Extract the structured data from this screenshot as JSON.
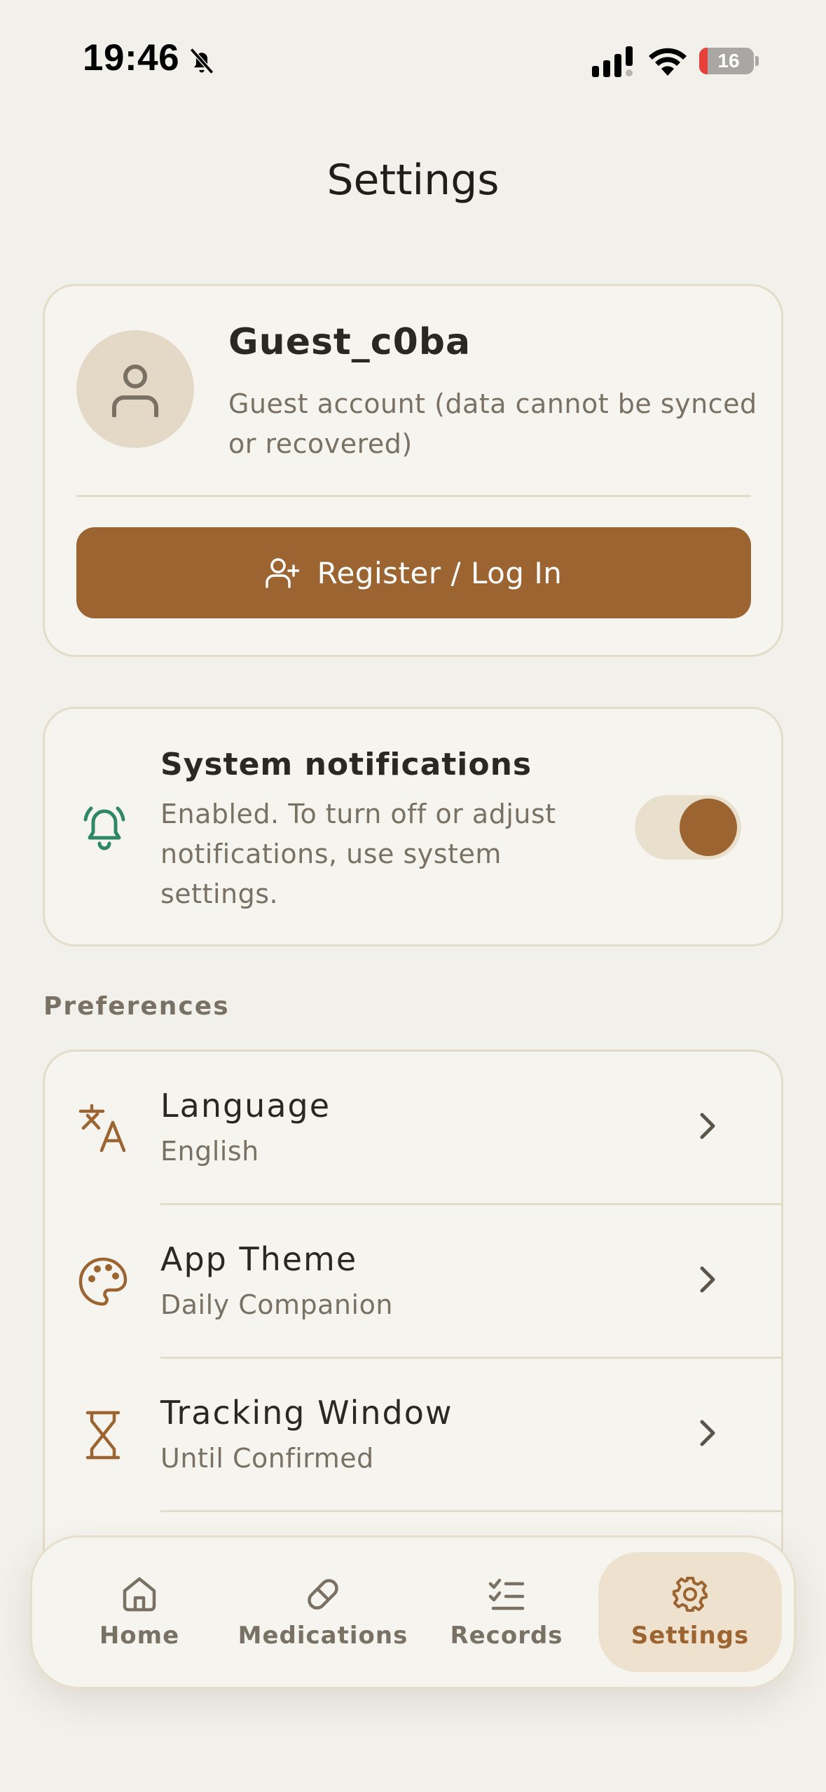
{
  "status_bar": {
    "time": "19:46",
    "battery_level": 16,
    "battery_color": "#E5403A"
  },
  "header": {
    "title": "Settings"
  },
  "account": {
    "name": "Guest_c0ba",
    "description": "Guest account (data cannot be synced or recovered)",
    "register_label": "Register / Log In",
    "avatar_icon": "user-icon"
  },
  "notifications": {
    "title": "System notifications",
    "description": "Enabled. To turn off or adjust notifications, use system settings.",
    "enabled": true,
    "icon": "bell-ringing-icon"
  },
  "preferences": {
    "section_label": "Preferences",
    "items": [
      {
        "title": "Language",
        "value": "English",
        "icon": "translate-icon"
      },
      {
        "title": "App Theme",
        "value": "Daily Companion",
        "icon": "palette-icon"
      },
      {
        "title": "Tracking Window",
        "value": "Until Confirmed",
        "icon": "hourglass-icon"
      }
    ]
  },
  "tab_bar": {
    "tabs": [
      {
        "label": "Home",
        "icon": "home-icon",
        "active": false
      },
      {
        "label": "Medications",
        "icon": "pill-icon",
        "active": false
      },
      {
        "label": "Records",
        "icon": "checklist-icon",
        "active": false
      },
      {
        "label": "Settings",
        "icon": "gear-icon",
        "active": true
      }
    ]
  },
  "colors": {
    "background": "#F2F0EB",
    "card": "#F6F4EF",
    "accent": "#9B6430",
    "notification_green": "#2E8868",
    "text_primary": "#2A2822",
    "text_secondary": "#7A7165"
  }
}
